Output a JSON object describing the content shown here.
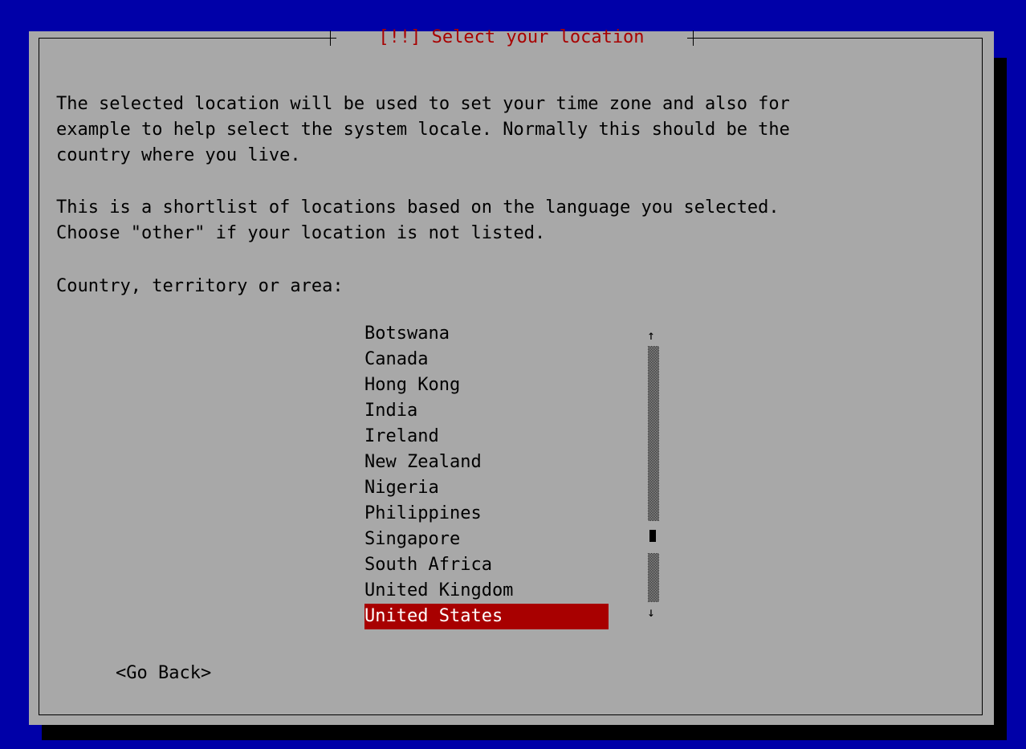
{
  "dialog": {
    "title": "[!!] Select your location",
    "description": "The selected location will be used to set your time zone and also for\nexample to help select the system locale. Normally this should be the\ncountry where you live.",
    "shortlist_note": "This is a shortlist of locations based on the language you selected.\nChoose \"other\" if your location is not listed.",
    "prompt": "Country, territory or area:"
  },
  "country_list": {
    "items": [
      {
        "label": "Botswana"
      },
      {
        "label": "Canada"
      },
      {
        "label": "Hong Kong"
      },
      {
        "label": "India"
      },
      {
        "label": "Ireland"
      },
      {
        "label": "New Zealand"
      },
      {
        "label": "Nigeria"
      },
      {
        "label": "Philippines"
      },
      {
        "label": "Singapore"
      },
      {
        "label": "South Africa"
      },
      {
        "label": "United Kingdom"
      },
      {
        "label": "United States"
      }
    ],
    "selected_index": 11,
    "scroll_up_icon": "↑",
    "scroll_down_icon": "↓"
  },
  "buttons": {
    "go_back": "<Go Back>"
  },
  "colors": {
    "screen_background": "#0000a8",
    "dialog_background": "#a8a8a8",
    "title_text": "#a80000",
    "selected_background": "#a80000",
    "selected_text": "#ffffff"
  }
}
